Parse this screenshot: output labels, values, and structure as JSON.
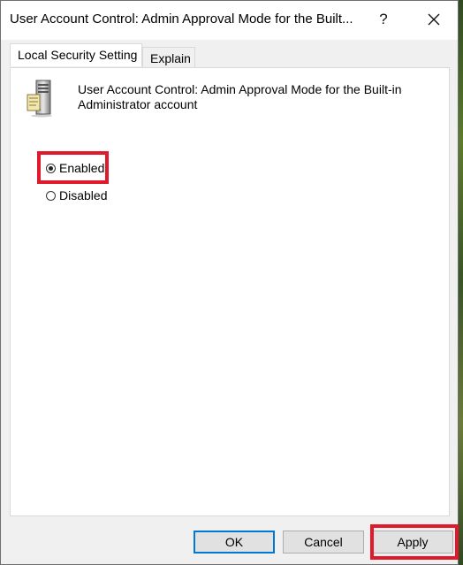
{
  "window": {
    "title": "User Account Control: Admin Approval Mode for the Built...",
    "help_glyph": "?",
    "close_icon": "close-icon"
  },
  "tabs": [
    {
      "label": "Local Security Setting",
      "active": true
    },
    {
      "label": "Explain",
      "active": false
    }
  ],
  "policy": {
    "icon": "policy-server-icon",
    "description": "User Account Control: Admin Approval Mode for the Built-in Administrator account"
  },
  "options": {
    "enabled_label": "Enabled",
    "disabled_label": "Disabled",
    "selected": "Enabled"
  },
  "buttons": {
    "ok_label": "OK",
    "cancel_label": "Cancel",
    "apply_label": "Apply"
  },
  "colors": {
    "highlight": "#e0192b",
    "focus": "#0078d7"
  }
}
